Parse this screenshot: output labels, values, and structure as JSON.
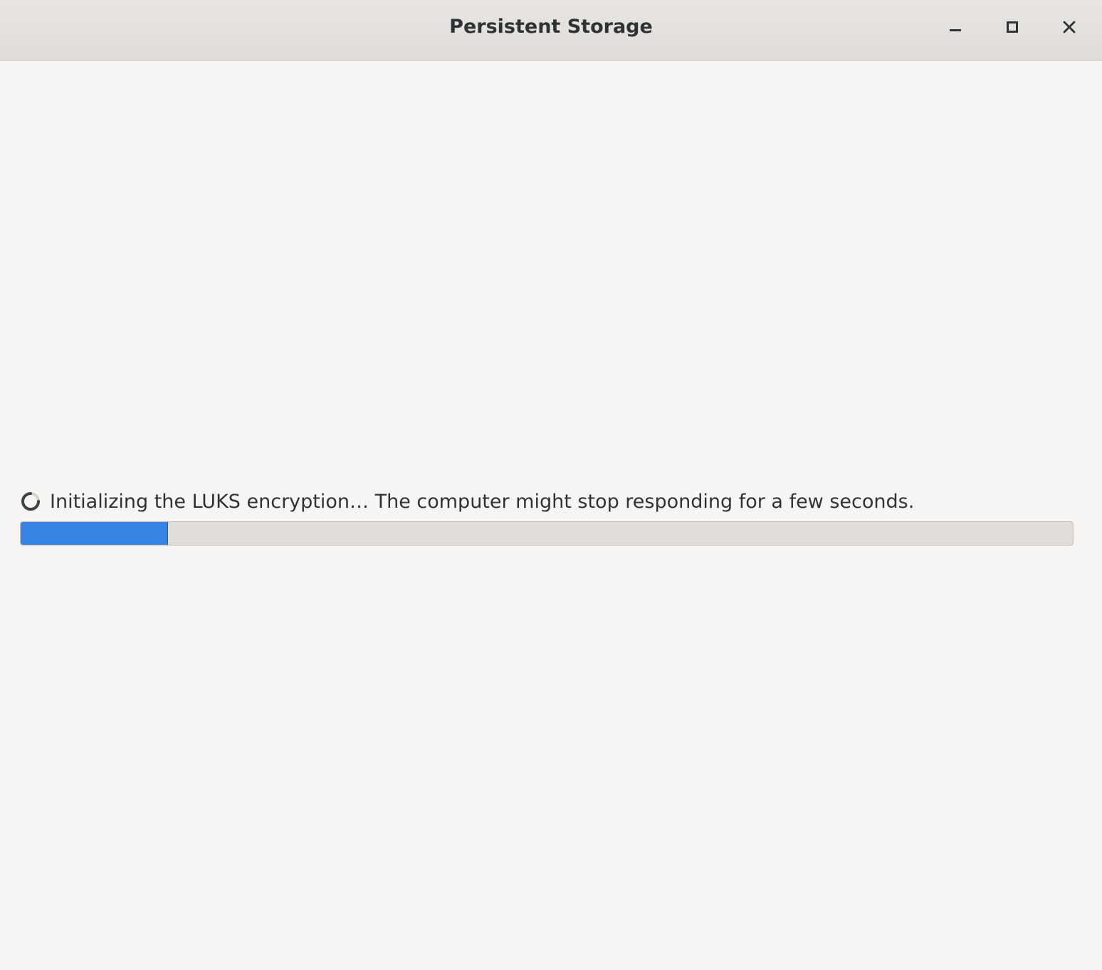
{
  "window": {
    "title": "Persistent Storage",
    "controls": {
      "minimize": "minimize-icon",
      "maximize": "maximize-icon",
      "close": "close-icon"
    }
  },
  "status": {
    "message": "Initializing the LUKS encryption… The computer might stop responding for a few seconds.",
    "spinner_icon": "spinner-icon"
  },
  "progress": {
    "fraction": 0.14,
    "fill_color": "#3584e4",
    "track_color": "#e0dcd9"
  }
}
